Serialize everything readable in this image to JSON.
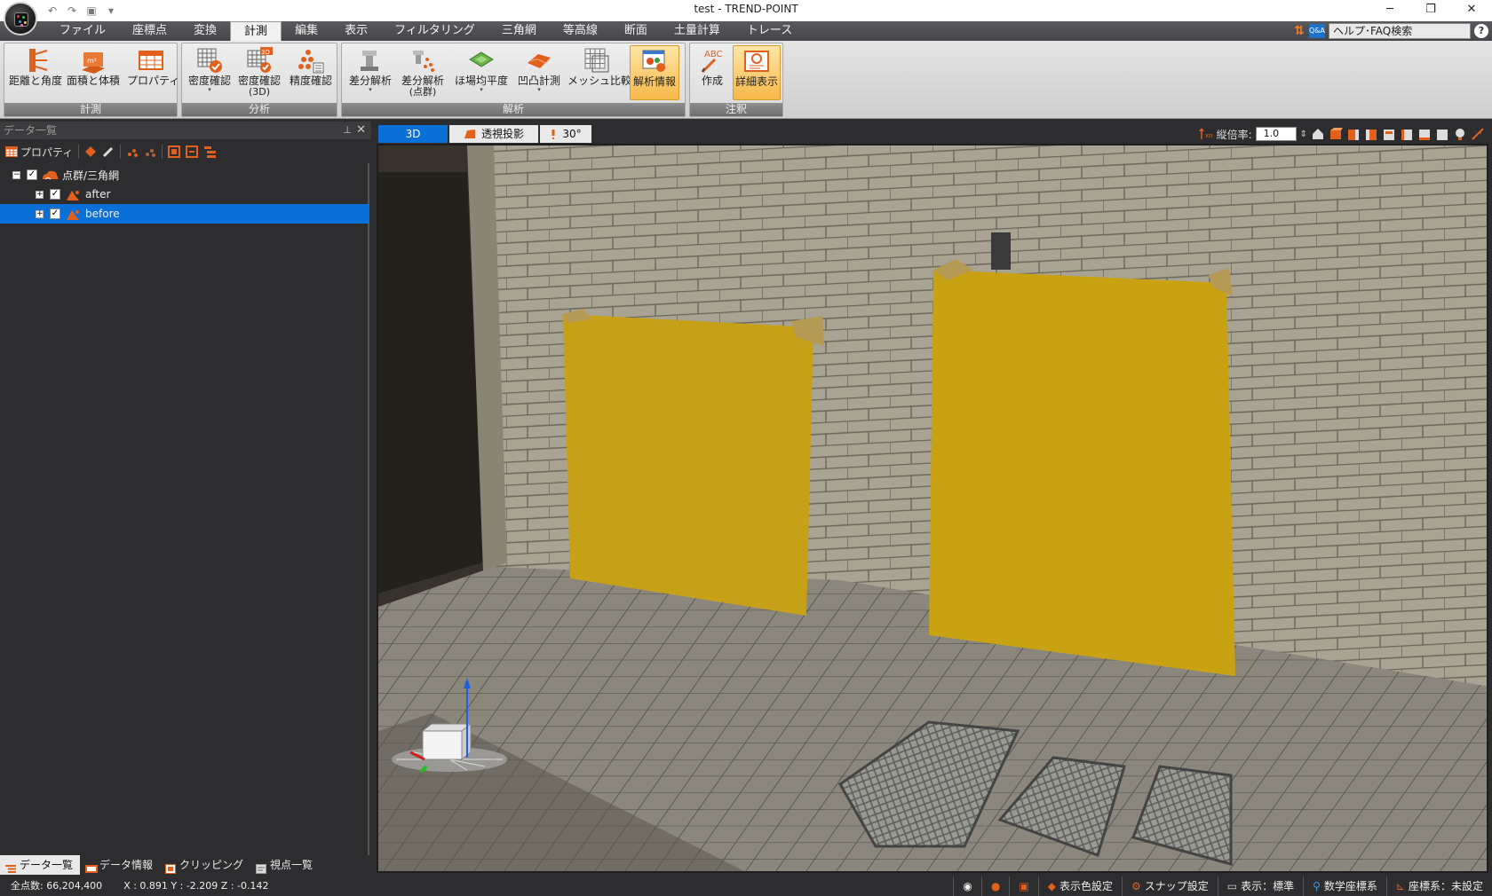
{
  "window": {
    "title": "test - TREND-POINT",
    "minimize_glyph": "─",
    "restore_glyph": "❐",
    "close_glyph": "✕",
    "qat_dropdown_glyph": "▾"
  },
  "menu": {
    "tabs": [
      "ファイル",
      "座標点",
      "変換",
      "計測",
      "編集",
      "表示",
      "フィルタリング",
      "三角網",
      "等高線",
      "断面",
      "土量計算",
      "トレース"
    ],
    "active_tab": "計測",
    "help_search_text": "ヘルプ･FAQ検索",
    "qa_badge": "Q&A",
    "help_glyph": "?"
  },
  "ribbon": {
    "groups": [
      {
        "label": "計測",
        "buttons": [
          {
            "label": "距離と角度"
          },
          {
            "label": "面積と体積"
          },
          {
            "label": "プロパティ"
          }
        ]
      },
      {
        "label": "分析",
        "buttons": [
          {
            "label": "密度確認",
            "dropdown": true
          },
          {
            "label": "密度確認",
            "sub": "(3D)",
            "dropdown": true
          },
          {
            "label": "精度確認"
          }
        ]
      },
      {
        "label": "解析",
        "buttons": [
          {
            "label": "差分解析",
            "dropdown": true
          },
          {
            "label": "差分解析",
            "sub": "(点群)",
            "dropdown": true
          },
          {
            "label": "ほ場均平度",
            "dropdown": true
          },
          {
            "label": "凹凸計測",
            "dropdown": true
          },
          {
            "label": "メッシュ比較"
          },
          {
            "label": "解析情報",
            "active": true
          }
        ]
      },
      {
        "label": "注釈",
        "buttons": [
          {
            "label": "作成"
          },
          {
            "label": "詳細表示",
            "active": true
          }
        ]
      }
    ],
    "icon_badge_3d": "3D",
    "abc_badge": "ABC"
  },
  "panel": {
    "title": "データ一覧",
    "pin_glyph": "⊥",
    "close_glyph": "✕",
    "toolbar_property": "プロパティ",
    "tree": [
      {
        "label": "点群/三角網",
        "checked": true,
        "expander": "−",
        "level": 0
      },
      {
        "label": "after",
        "checked": true,
        "expander": "+",
        "level": 1
      },
      {
        "label": "before",
        "checked": true,
        "expander": "+",
        "level": 1,
        "selected": true
      }
    ],
    "check_glyph": "✓",
    "tabs": [
      "データ一覧",
      "データ情報",
      "クリッピング",
      "視点一覧"
    ]
  },
  "view": {
    "tab_3d": "3D",
    "tab_projection": "透視投影",
    "tab_angle": "30°",
    "vertical_scale_label": "縦倍率:",
    "vertical_scale_value": "1.0",
    "spinner_glyph": "⇕"
  },
  "status": {
    "total_points": "全点数: 66,204,400",
    "coords": "X : 0.891  Y : -2.209  Z : -0.142",
    "buttons": [
      "表示色設定",
      "スナップ設定",
      "表示：標準",
      "数学座標系",
      "座標系：未設定"
    ]
  },
  "colors": {
    "accent_blue": "#0a6fd6",
    "active_orange": "#f7b84a",
    "panel_dark": "#2d2d30",
    "yellow_panel": "#c9a214"
  }
}
